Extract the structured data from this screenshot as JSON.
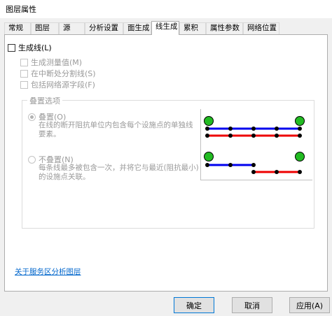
{
  "window": {
    "title": "图层属性"
  },
  "tabs": [
    {
      "label": "常规"
    },
    {
      "label": "图层"
    },
    {
      "label": "源"
    },
    {
      "label": "分析设置"
    },
    {
      "label": "面生成"
    },
    {
      "label": "线生成"
    },
    {
      "label": "累积"
    },
    {
      "label": "属性参数"
    },
    {
      "label": "网络位置"
    }
  ],
  "active_tab": "线生成",
  "line_gen": {
    "generate_lines": {
      "label": "生成线(L)",
      "checked": false
    },
    "measure_values": {
      "label": "生成测量值(M)",
      "checked": false
    },
    "split_at_breaks": {
      "label": "在中断处分割线(S)",
      "checked": false
    },
    "include_source_fields": {
      "label": "包括网络源字段(F)",
      "checked": false
    }
  },
  "overlap": {
    "legend": "叠置选项",
    "overlap_option": {
      "label": "叠置(O)",
      "selected": true,
      "desc_line1": "在线的断开阻抗单位内包含每个设施点的单独线",
      "desc_line2": "要素。"
    },
    "no_overlap_option": {
      "label": "不叠置(N)",
      "selected": false,
      "desc_line1": "每条线最多被包含一次，并将它与最近(阻抗最小)",
      "desc_line2": "的设施点关联。"
    }
  },
  "colors": {
    "facility": "#22bb22",
    "line_blue": "#0000ee",
    "line_red": "#ee0000",
    "vertex": "#000000"
  },
  "link": {
    "label": "关于服务区分析图层"
  },
  "buttons": {
    "ok": "确定",
    "cancel": "取消",
    "apply": "应用(A)"
  }
}
